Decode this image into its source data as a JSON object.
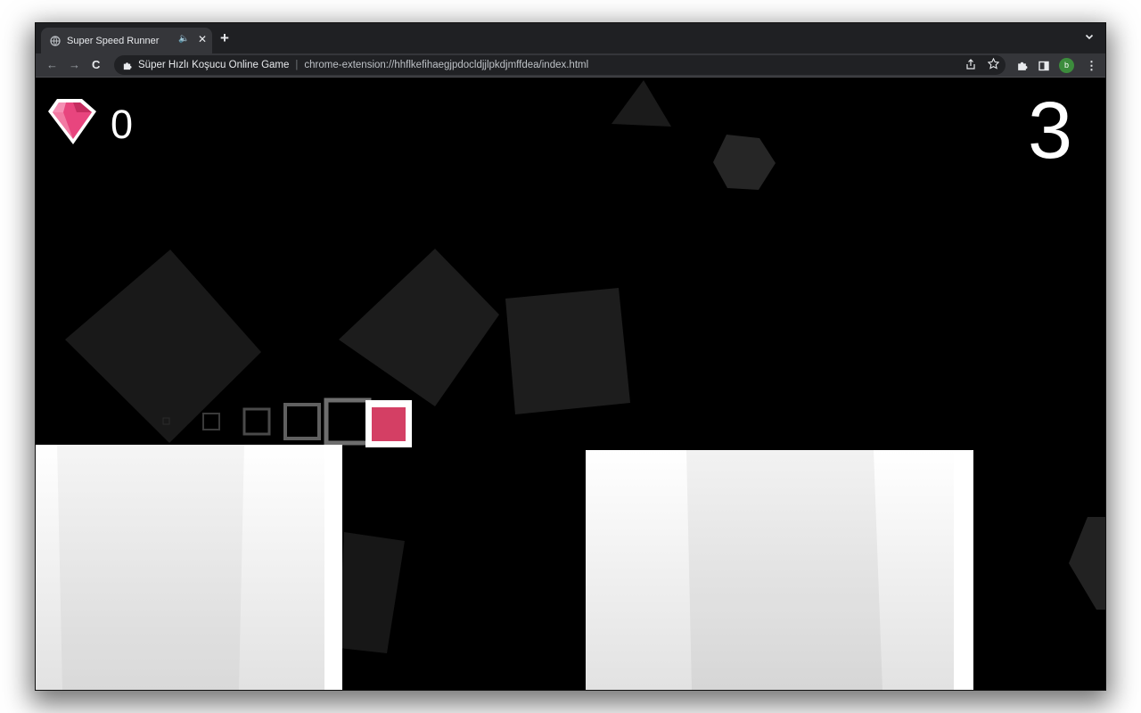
{
  "browser": {
    "tab": {
      "title": "Super Speed Runner",
      "favicon": "globe-icon",
      "mute_glyph": "🔈",
      "close_glyph": "✕"
    },
    "new_tab_glyph": "+",
    "tab_search_icon": "chevron-down-icon",
    "nav": {
      "back_glyph": "←",
      "forward_glyph": "→",
      "reload_glyph": "C"
    },
    "omnibox": {
      "site_name": "Süper Hızlı Koşucu Online Game",
      "url": "chrome-extension://hhflkefihaegjpdocldjjlpkdjmffdea/index.html"
    },
    "profile_initial": "b",
    "menu_glyph": "⋮"
  },
  "game": {
    "gem_count": "0",
    "lives": "3",
    "colors": {
      "background": "#000000",
      "player": "#d43f64",
      "gem": "#e8457e",
      "platform": "#ffffff",
      "shape": "#222222"
    }
  }
}
